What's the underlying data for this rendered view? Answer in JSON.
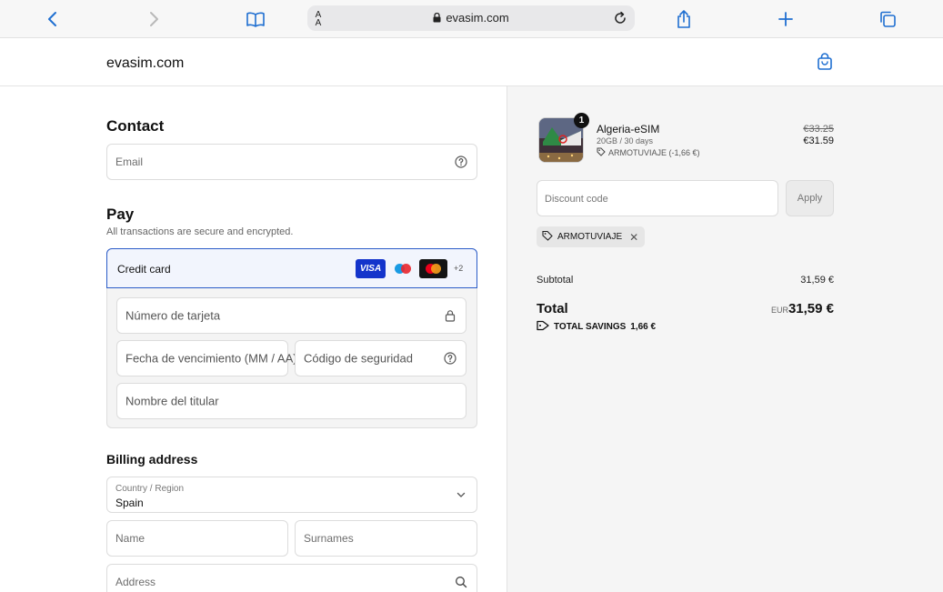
{
  "browser": {
    "text_size_label": "A A",
    "url": "evasim.com"
  },
  "store": {
    "name": "evasim.com"
  },
  "contact": {
    "title": "Contact",
    "email_placeholder": "Email"
  },
  "pay": {
    "title": "Pay",
    "subtitle": "All transactions are secure and encrypted.",
    "method_label": "Credit card",
    "brands": [
      "VISA",
      "maestro",
      "mastercard"
    ],
    "more_brands": "+2",
    "card_number_placeholder": "Número de tarjeta",
    "expiry_placeholder": "Fecha de vencimiento (MM / AA)",
    "cvv_placeholder": "Código de seguridad",
    "holder_placeholder": "Nombre del titular"
  },
  "billing": {
    "title": "Billing address",
    "country_label": "Country / Region",
    "country_value": "Spain",
    "name_placeholder": "Name",
    "surnames_placeholder": "Surnames",
    "address_placeholder": "Address"
  },
  "order": {
    "quantity": "1",
    "product_name": "Algeria-eSIM",
    "product_detail": "20GB / 30 days",
    "product_discount": "ARMOTUVIAJE (-1,66 €)",
    "price_old": "€33.25",
    "price_new": "€31.59",
    "discount_placeholder": "Discount code",
    "apply_label": "Apply",
    "applied_code": "ARMOTUVIAJE",
    "subtotal_label": "Subtotal",
    "subtotal_value": "31,59 €",
    "total_label": "Total",
    "currency": "EUR",
    "total_value": "31,59 €",
    "savings_label": "TOTAL SAVINGS",
    "savings_value": "1,66 €"
  },
  "colors": {
    "accent": "#1f6fd1",
    "card_selected_border": "#2b5cc8",
    "visa": "#1434cb"
  },
  "icons": [
    "back-icon",
    "forward-icon",
    "bookmarks-icon",
    "lock-icon",
    "reload-icon",
    "share-icon",
    "new-tab-icon",
    "tabs-icon",
    "bag-icon",
    "help-icon",
    "chevron-down-icon",
    "search-icon",
    "tag-icon",
    "close-icon"
  ]
}
